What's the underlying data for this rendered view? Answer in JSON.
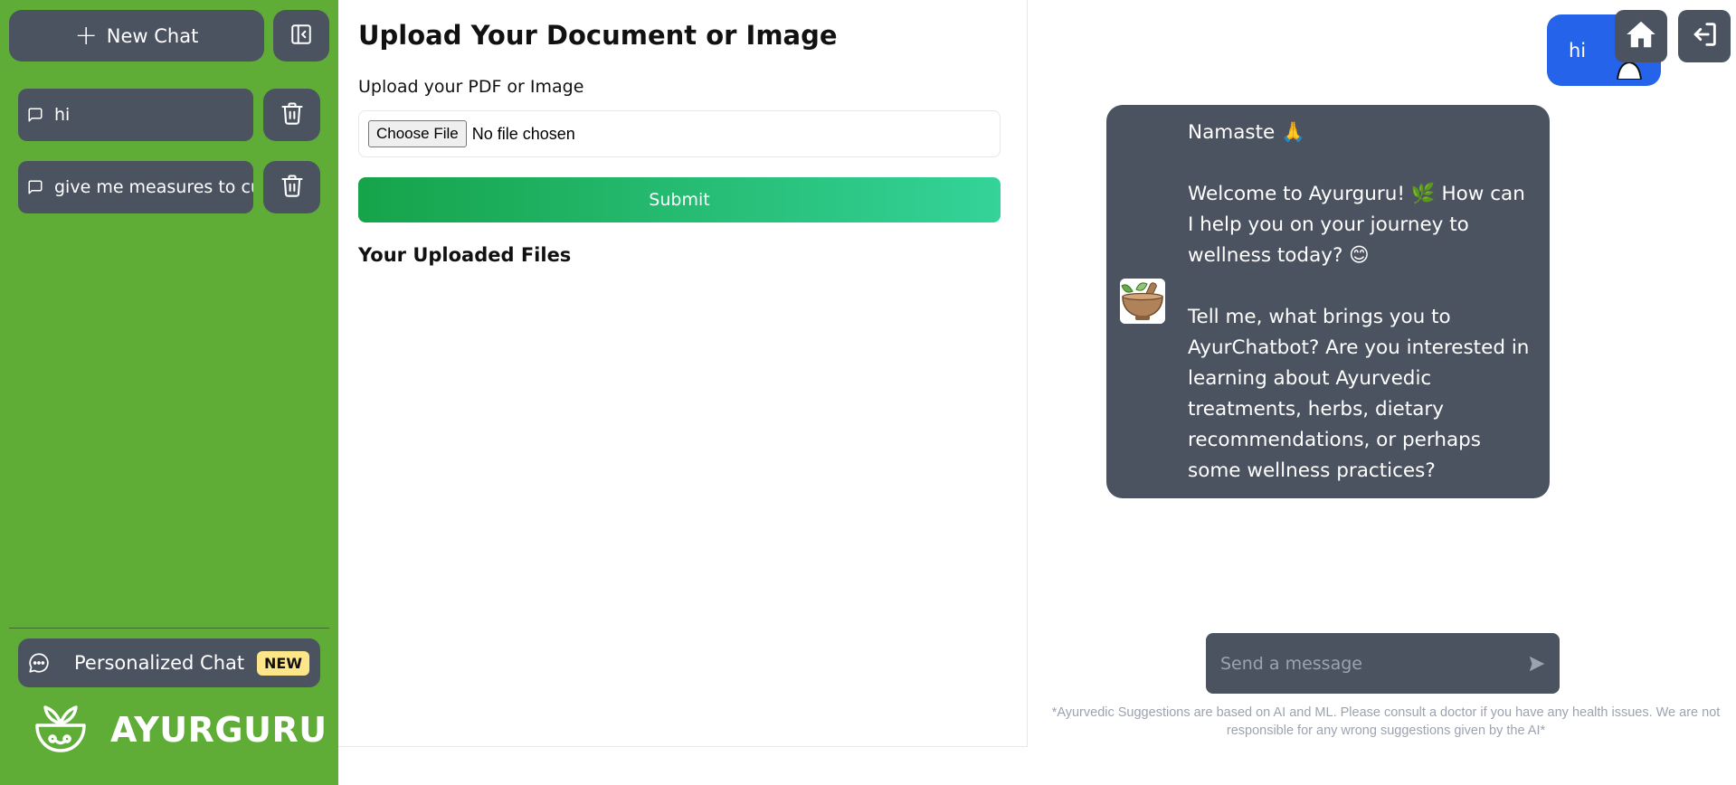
{
  "sidebar": {
    "new_chat_label": "New Chat",
    "chats": [
      {
        "label": "hi"
      },
      {
        "label": "give me measures to cure"
      }
    ],
    "personalized_label": "Personalized Chat",
    "new_badge": "NEW",
    "brand": "AYURGURU"
  },
  "upload": {
    "title": "Upload Your Document or Image",
    "label": "Upload your PDF or Image",
    "choose_file": "Choose File",
    "file_status": "No file chosen",
    "submit": "Submit",
    "uploaded_heading": "Your Uploaded Files"
  },
  "chat": {
    "user_message": "hi",
    "bot_paragraphs": [
      "Namaste 🙏",
      "Welcome to Ayurguru! 🌿 How can I help you on your journey to wellness today? 😊",
      "Tell me,  what brings you to AyurChatbot? Are you interested in learning about Ayurvedic treatments, herbs, dietary recommendations, or perhaps some wellness practices?"
    ],
    "input_placeholder": "Send a message",
    "disclaimer": "*Ayurvedic Suggestions are based on AI and ML. Please consult a doctor if you have any health issues. We are not responsible for any wrong suggestions given by the AI*"
  },
  "icons": {
    "new_chat": "plus-icon",
    "collapse": "sidebar-collapse-icon",
    "chat": "message-square-icon",
    "delete": "trash-icon",
    "personalized": "message-circle-dots-icon",
    "brand": "bowl-leaves-logo",
    "home": "home-icon",
    "logout": "logout-icon",
    "send": "send-icon"
  },
  "colors": {
    "sidebar_bg": "#5fac37",
    "button_bg": "#4b5361",
    "user_bubble": "#2563eb",
    "submit_gradient_start": "#16a34a",
    "submit_gradient_end": "#34d399",
    "badge_bg": "#fde68a"
  }
}
